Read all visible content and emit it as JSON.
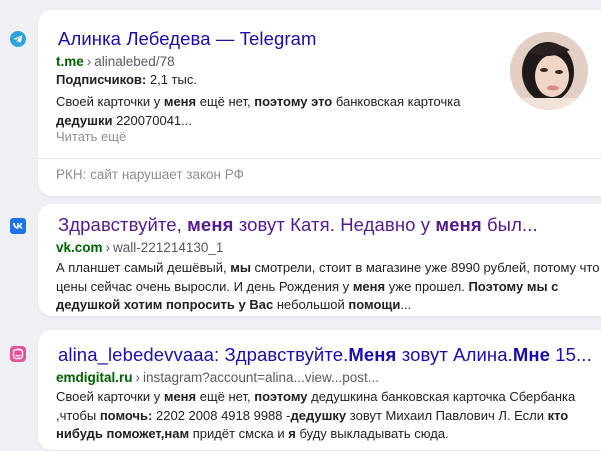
{
  "results": [
    {
      "favicon": "telegram-icon",
      "title": "Алинка Лебедева — Telegram",
      "host": "t.me",
      "path": "alinalebed/78",
      "subscribers_label": "Подписчиков:",
      "subscribers_value": "2,1 тыс.",
      "snippet_parts": [
        {
          "t": "Своей карточки у ",
          "b": false
        },
        {
          "t": "меня",
          "b": true
        },
        {
          "t": " ещё нет, ",
          "b": false
        },
        {
          "t": "поэтому это",
          "b": true
        },
        {
          "t": " банковская карточка ",
          "b": false
        },
        {
          "t": "дедушки",
          "b": true
        },
        {
          "t": " 220070041...",
          "b": false
        }
      ],
      "read_more": "Читать ещё",
      "warning": "РКН: сайт нарушает закон РФ",
      "title_color": "#1a0dab"
    },
    {
      "favicon": "vk-icon",
      "title_parts": [
        {
          "t": "Здравствуйте, ",
          "b": false
        },
        {
          "t": "меня",
          "b": true
        },
        {
          "t": " зовут Катя. Недавно у ",
          "b": false
        },
        {
          "t": "меня",
          "b": true
        },
        {
          "t": " был...",
          "b": false
        }
      ],
      "host": "vk.com",
      "path": "wall-221214130_1",
      "snippet_parts": [
        {
          "t": "А планшет самый дешёвый, ",
          "b": false
        },
        {
          "t": "мы",
          "b": true
        },
        {
          "t": " смотрели, стоит в магазине уже 8990 рублей, потому что цены сейчас очень выросли. И день Рождения у ",
          "b": false
        },
        {
          "t": "меня",
          "b": true
        },
        {
          "t": " уже прошел. ",
          "b": false
        },
        {
          "t": "Поэтому мы с дедушкой хотим попросить у",
          "b": true
        },
        {
          "t": " ",
          "b": false
        },
        {
          "t": "Вас",
          "b": true
        },
        {
          "t": " небольшой ",
          "b": false
        },
        {
          "t": "помощи",
          "b": true
        },
        {
          "t": "...",
          "b": false
        }
      ],
      "title_color": "#551a8b"
    },
    {
      "favicon": "emdigital-icon",
      "title_parts": [
        {
          "t": "alina_lebedevvaaa: Здравствуйте.",
          "b": false
        },
        {
          "t": "Меня",
          "b": true
        },
        {
          "t": " зовут Алина.",
          "b": false
        },
        {
          "t": "Мне",
          "b": true
        },
        {
          "t": " 15...",
          "b": false
        }
      ],
      "host": "emdigital.ru",
      "path": "instagram?account=alina...view...post...",
      "snippet_parts": [
        {
          "t": "Своей карточки у ",
          "b": false
        },
        {
          "t": "меня",
          "b": true
        },
        {
          "t": " ещё нет, ",
          "b": false
        },
        {
          "t": "поэтому",
          "b": true
        },
        {
          "t": " дедушкина банковская карточка Сбербанка ,чтобы ",
          "b": false
        },
        {
          "t": "помочь:",
          "b": true
        },
        {
          "t": " 2202 2008 4918 9988 -",
          "b": false
        },
        {
          "t": "дедушку",
          "b": true
        },
        {
          "t": " зовут Михаил Павлович Л. Если ",
          "b": false
        },
        {
          "t": "кто нибудь поможет,нам",
          "b": true
        },
        {
          "t": " придёт смска и ",
          "b": false
        },
        {
          "t": "я",
          "b": true
        },
        {
          "t": " буду выкладывать сюда.",
          "b": false
        }
      ],
      "title_color": "#1a0dab"
    }
  ]
}
